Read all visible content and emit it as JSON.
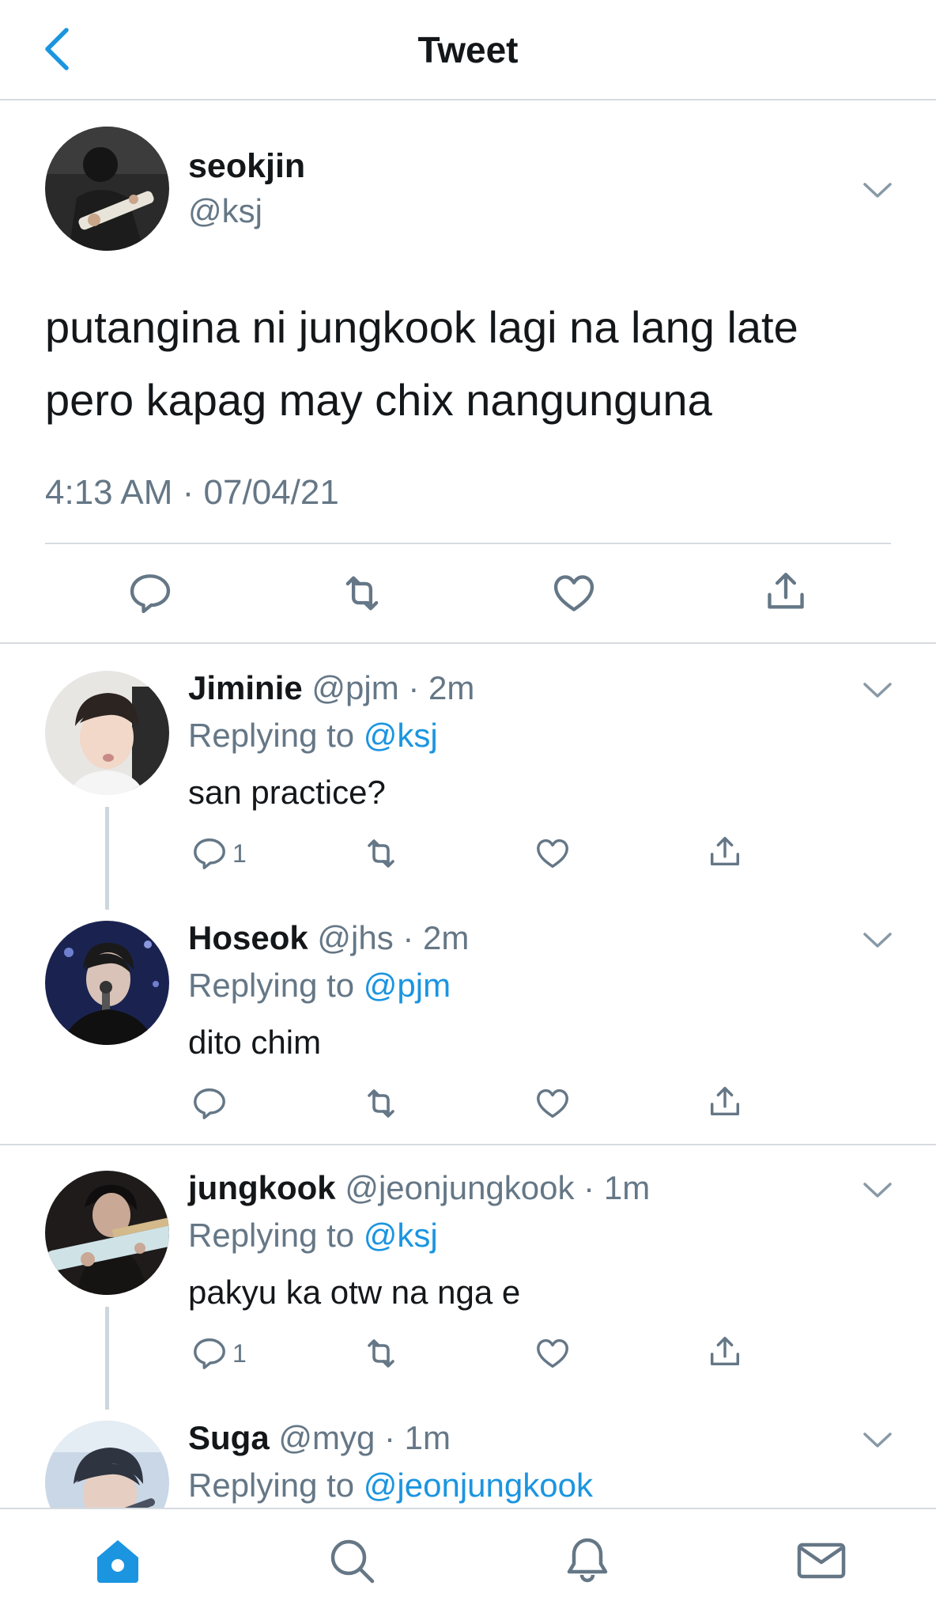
{
  "header": {
    "title": "Tweet"
  },
  "main_tweet": {
    "name": "seokjin",
    "handle": "@ksj",
    "text_line1": "putangina ni jungkook lagi na lang late",
    "text_line2": "pero kapag may chix nangunguna",
    "timestamp": "4:13 AM · 07/04/21"
  },
  "replies": [
    {
      "name": "Jiminie",
      "meta": "@pjm · 2m",
      "replying_label": "Replying to",
      "replying_to": "@ksj",
      "text": "san practice?",
      "reply_count": "1"
    },
    {
      "name": "Hoseok",
      "meta": "@jhs · 2m",
      "replying_label": "Replying to",
      "replying_to": "@pjm",
      "text": "dito chim",
      "reply_count": ""
    },
    {
      "name": "jungkook",
      "meta": "@jeonjungkook · 1m",
      "replying_label": "Replying to",
      "replying_to": "@ksj",
      "text": "pakyu ka otw na nga e",
      "reply_count": "1"
    },
    {
      "name": "Suga",
      "meta": "@myg · 1m",
      "replying_label": "Replying to",
      "replying_to": "@jeonjungkook"
    }
  ],
  "icons": {
    "back": "chevron-left-icon",
    "reply": "speech-bubble-icon",
    "retweet": "retweet-icon",
    "like": "heart-icon",
    "share": "share-icon",
    "more": "chevron-down-icon",
    "nav_home": "home-icon",
    "nav_search": "search-icon",
    "nav_notifications": "bell-icon",
    "nav_messages": "mail-icon"
  },
  "colors": {
    "accent": "#1b95e0",
    "muted": "#657786",
    "text": "#14171a",
    "divider": "#d6dbe0"
  }
}
